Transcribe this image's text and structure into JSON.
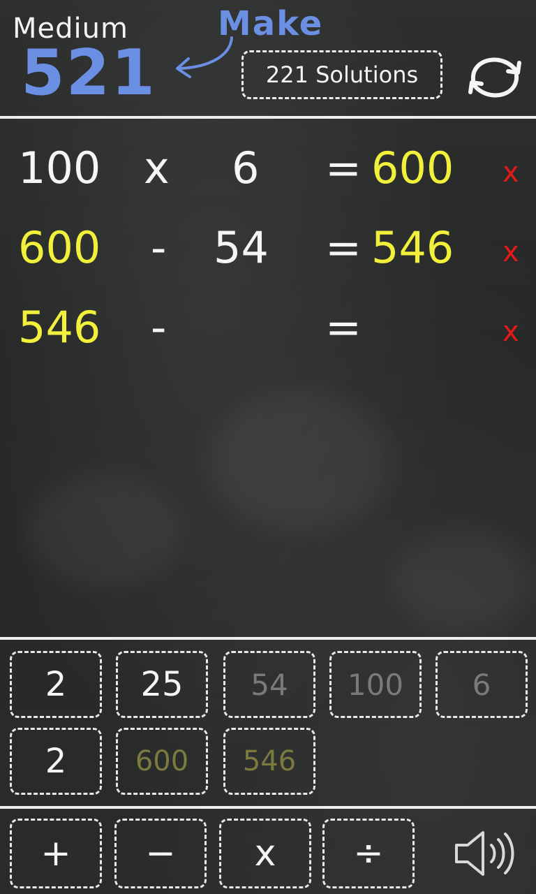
{
  "header": {
    "difficulty": "Medium",
    "target": "521",
    "make_label": "Make",
    "solutions_label": "221 Solutions"
  },
  "equations": [
    {
      "left": "100",
      "op": "x",
      "right": "6",
      "eq": "=",
      "result": "600",
      "delete": "x"
    },
    {
      "left": "600",
      "op": "-",
      "right": "54",
      "eq": "=",
      "result": "546",
      "delete": "x"
    },
    {
      "left": "546",
      "op": "-",
      "right": "",
      "eq": "=",
      "result": "",
      "delete": "x"
    }
  ],
  "numbers": [
    {
      "value": "2",
      "state": "available"
    },
    {
      "value": "25",
      "state": "available"
    },
    {
      "value": "54",
      "state": "used"
    },
    {
      "value": "100",
      "state": "used"
    },
    {
      "value": "6",
      "state": "used"
    },
    {
      "value": "2",
      "state": "available"
    },
    {
      "value": "600",
      "state": "derived-used"
    },
    {
      "value": "546",
      "state": "derived-used"
    }
  ],
  "operators": [
    "+",
    "−",
    "x",
    "÷"
  ],
  "icons": {
    "refresh": "refresh-icon",
    "sound": "speaker-icon",
    "arrow": "arrow-icon"
  },
  "colors": {
    "target": "#6b8fe3",
    "result": "#f1f03a",
    "delete": "#e41a1a",
    "chalk": "#f5f5f5"
  }
}
